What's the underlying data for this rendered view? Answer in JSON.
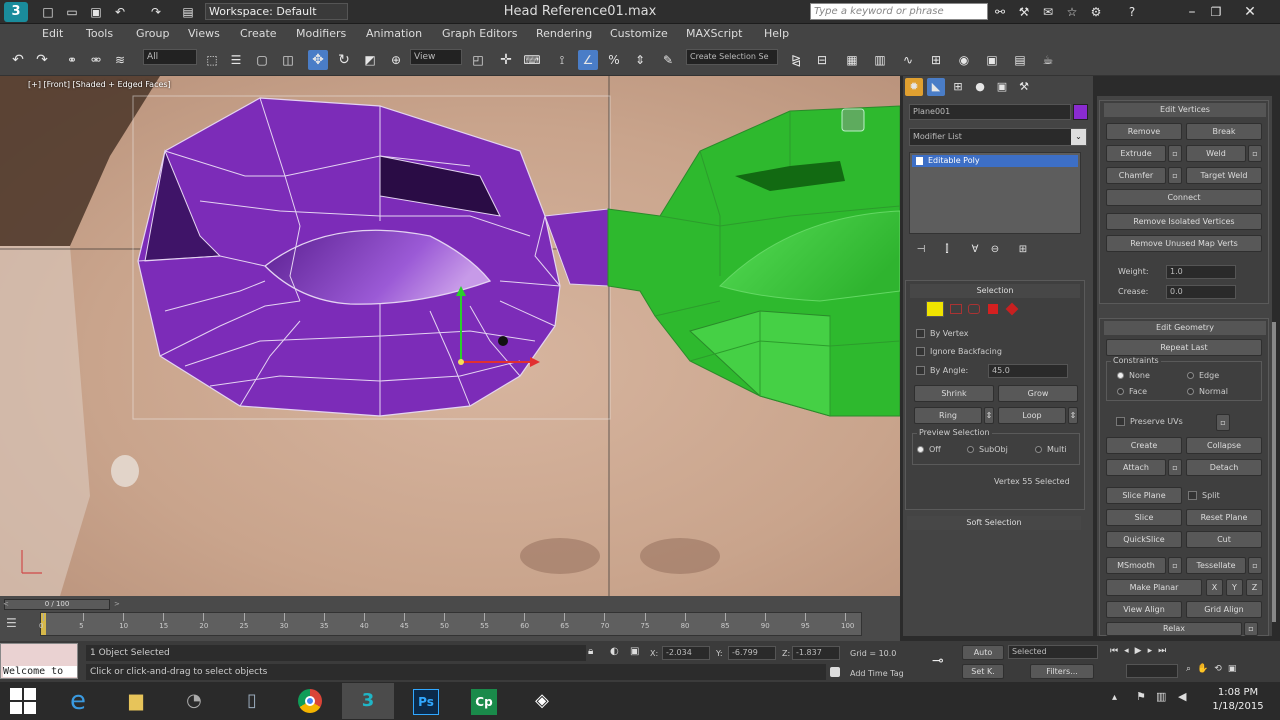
{
  "title_bar": {
    "workspace_label": "Workspace: Default",
    "file_title": "Head Reference01.max",
    "search_placeholder": "Type a keyword or phrase"
  },
  "menu": [
    "Edit",
    "Tools",
    "Group",
    "Views",
    "Create",
    "Modifiers",
    "Animation",
    "Graph Editors",
    "Rendering",
    "Customize",
    "MAXScript",
    "Help"
  ],
  "toolbar": {
    "filter_dropdown": "All",
    "view_dropdown": "View",
    "create_selection_dropdown": "Create Selection Se"
  },
  "viewport": {
    "label": "[+] [Front] [Shaded + Edged Faces]",
    "right_panel_colors": {
      "mesh_left": "#7b2bb8",
      "mesh_right": "#2ec02e",
      "edge": "#e0d0f0"
    }
  },
  "command_panel": {
    "object_name": "Plane001",
    "object_color": "#8a2bd0",
    "modifier_list_label": "Modifier List",
    "stack_item": "Editable Poly",
    "selection": {
      "title": "Selection",
      "by_vertex": "By Vertex",
      "ignore_backfacing": "Ignore Backfacing",
      "by_angle": "By Angle:",
      "by_angle_value": "45.0",
      "shrink": "Shrink",
      "grow": "Grow",
      "ring": "Ring",
      "loop": "Loop",
      "preview_selection": "Preview Selection",
      "preview_options": [
        "Off",
        "SubObj",
        "Multi"
      ],
      "status": "Vertex 55 Selected"
    },
    "soft_selection": "Soft Selection"
  },
  "edit_vertices": {
    "title": "Edit Vertices",
    "remove": "Remove",
    "break": "Break",
    "extrude": "Extrude",
    "weld": "Weld",
    "chamfer": "Chamfer",
    "target_weld": "Target Weld",
    "connect": "Connect",
    "remove_isolated": "Remove Isolated Vertices",
    "remove_unused": "Remove Unused Map Verts",
    "weight_label": "Weight:",
    "weight_value": "1.0",
    "crease_label": "Crease:",
    "crease_value": "0.0"
  },
  "edit_geometry": {
    "title": "Edit Geometry",
    "repeat_last": "Repeat Last",
    "constraints": "Constraints",
    "constraint_options": [
      "None",
      "Edge",
      "Face",
      "Normal"
    ],
    "preserve_uvs": "Preserve UVs",
    "create": "Create",
    "collapse": "Collapse",
    "attach": "Attach",
    "detach": "Detach",
    "slice_plane": "Slice Plane",
    "split": "Split",
    "slice": "Slice",
    "reset_plane": "Reset Plane",
    "quickslice": "QuickSlice",
    "cut": "Cut",
    "msmooth": "MSmooth",
    "tessellate": "Tessellate",
    "make_planar": "Make Planar",
    "x": "X",
    "y": "Y",
    "z": "Z",
    "view_align": "View Align",
    "grid_align": "Grid Align",
    "relax": "Relax"
  },
  "timeline": {
    "frame_indicator": "0 / 100",
    "ticks": [
      "0",
      "5",
      "10",
      "15",
      "20",
      "25",
      "30",
      "35",
      "40",
      "45",
      "50",
      "55",
      "60",
      "65",
      "70",
      "75",
      "80",
      "85",
      "90",
      "95",
      "100"
    ]
  },
  "status": {
    "welcome": "Welcome to",
    "selected": "1 Object Selected",
    "prompt": "Click or click-and-drag to select objects",
    "x_label": "X:",
    "x_value": "-2.034",
    "y_label": "Y:",
    "y_value": "-6.799",
    "z_label": "Z:",
    "z_value": "-1.837",
    "grid": "Grid = 10.0",
    "add_time_tag": "Add Time Tag",
    "auto": "Auto",
    "set_key": "Set K.",
    "selected_dropdown": "Selected",
    "filters": "Filters..."
  },
  "taskbar": {
    "time": "1:08 PM",
    "date": "1/18/2015"
  }
}
